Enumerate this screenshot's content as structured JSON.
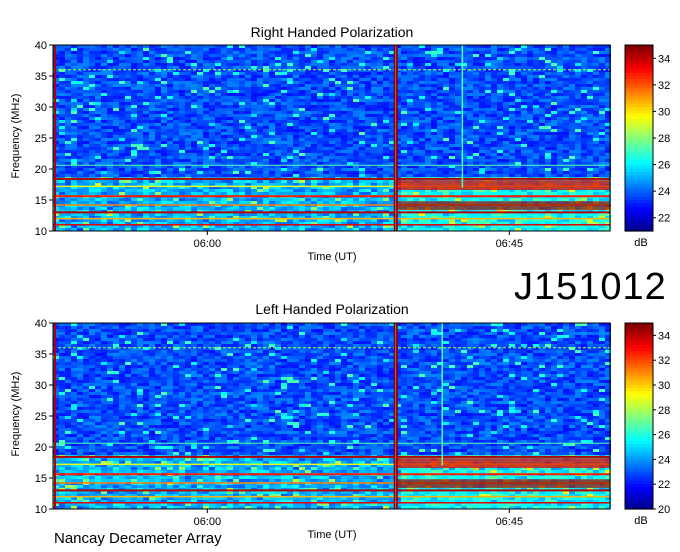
{
  "chart_data": [
    {
      "type": "heatmap",
      "title": "Right Handed Polarization",
      "xlabel": "Time (UT)",
      "ylabel": "Frequency (MHz)",
      "ylim": [
        10,
        40
      ],
      "yticks": [
        10,
        15,
        20,
        25,
        30,
        35,
        40
      ],
      "x_ticks": [
        "06:00",
        "06:45"
      ],
      "colorbar": {
        "label": "dB",
        "range": [
          21,
          35
        ],
        "ticks": [
          22,
          24,
          26,
          28,
          30,
          32,
          34
        ]
      },
      "features": [
        {
          "kind": "vertical-burst",
          "time": "06:28",
          "color": "#8b0000"
        },
        {
          "kind": "vertical-line",
          "time": "06:38"
        },
        {
          "kind": "bright-band",
          "freq_range": [
            10,
            19
          ],
          "note": "intense emission after 06:28"
        },
        {
          "kind": "horizontal-line",
          "freq": 36
        }
      ]
    },
    {
      "type": "heatmap",
      "title": "Left Handed Polarization",
      "xlabel": "Time (UT)",
      "ylabel": "Frequency (MHz)",
      "ylim": [
        10,
        40
      ],
      "yticks": [
        10,
        15,
        20,
        25,
        30,
        35,
        40
      ],
      "x_ticks": [
        "06:00",
        "06:45"
      ],
      "colorbar": {
        "label": "dB",
        "range": [
          20,
          35
        ],
        "ticks": [
          20,
          22,
          24,
          26,
          28,
          30,
          32,
          34
        ]
      },
      "features": [
        {
          "kind": "vertical-burst",
          "time": "06:28",
          "color": "#8b0000"
        },
        {
          "kind": "vertical-line",
          "time": "06:35"
        },
        {
          "kind": "bright-band",
          "freq_range": [
            10,
            19
          ],
          "note": "intense emission after 06:28"
        },
        {
          "kind": "horizontal-line",
          "freq": 36
        }
      ]
    }
  ],
  "observation_id": "J151012",
  "footer": "Nancay Decameter Array",
  "colors": {
    "low": "#00008f",
    "mid": "#00ffff",
    "high": "#ffff00",
    "max": "#8b0000"
  }
}
